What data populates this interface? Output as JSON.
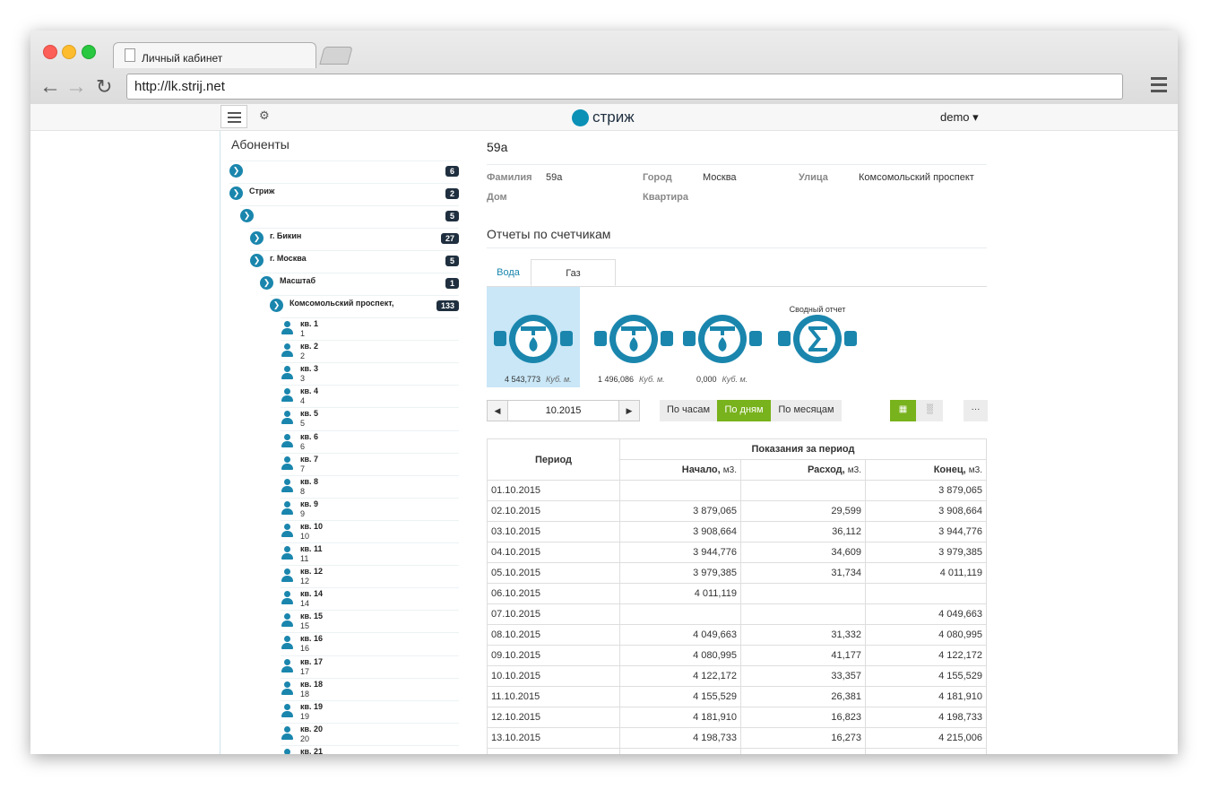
{
  "browser": {
    "tab_title": "Личный кабинет",
    "url": "http://lk.strij.net"
  },
  "topbar": {
    "brand": "стриж",
    "user": "demo ▾"
  },
  "sidebar": {
    "title": "Абоненты",
    "groups": [
      {
        "label": "",
        "count": "6",
        "expanded": false
      },
      {
        "label": "Стриж",
        "count": "2",
        "expanded": true
      },
      {
        "label": "",
        "count": "5",
        "expanded": true
      },
      {
        "label": "г. Бикин",
        "count": "27",
        "expanded": false
      },
      {
        "label": "г. Москва",
        "count": "5",
        "expanded": true
      },
      {
        "label": "Масштаб",
        "count": "1",
        "expanded": true
      },
      {
        "label": "Комсомольский проспект,",
        "count": "133",
        "expanded": true
      }
    ],
    "apartments": [
      {
        "name": "кв. 1",
        "num": "1"
      },
      {
        "name": "кв. 2",
        "num": "2"
      },
      {
        "name": "кв. 3",
        "num": "3"
      },
      {
        "name": "кв. 4",
        "num": "4"
      },
      {
        "name": "кв. 5",
        "num": "5"
      },
      {
        "name": "кв. 6",
        "num": "6"
      },
      {
        "name": "кв. 7",
        "num": "7"
      },
      {
        "name": "кв. 8",
        "num": "8"
      },
      {
        "name": "кв. 9",
        "num": "9"
      },
      {
        "name": "кв. 10",
        "num": "10"
      },
      {
        "name": "кв. 11",
        "num": "11"
      },
      {
        "name": "кв. 12",
        "num": "12"
      },
      {
        "name": "кв. 14",
        "num": "14"
      },
      {
        "name": "кв. 15",
        "num": "15"
      },
      {
        "name": "кв. 16",
        "num": "16"
      },
      {
        "name": "кв. 17",
        "num": "17"
      },
      {
        "name": "кв. 18",
        "num": "18"
      },
      {
        "name": "кв. 19",
        "num": "19"
      },
      {
        "name": "кв. 20",
        "num": "20"
      },
      {
        "name": "кв. 21",
        "num": ""
      }
    ]
  },
  "main": {
    "name": "59а",
    "info": {
      "surname_label": "Фамилия",
      "surname": "59а",
      "city_label": "Город",
      "city": "Москва",
      "street_label": "Улица",
      "street": "Комсомольский проспект",
      "house_label": "Дом",
      "flat_label": "Квартира"
    },
    "reports_title": "Отчеты по счетчикам",
    "tabs": {
      "water": "Вода",
      "gas": "Газ"
    },
    "meters": [
      {
        "value": "4 543,773",
        "unit": "Куб. м."
      },
      {
        "value": "1 496,086",
        "unit": "Куб. м."
      },
      {
        "value": "0,000",
        "unit": "Куб. м."
      }
    ],
    "summary_label": "Сводный отчет",
    "date": "10.2015",
    "period_buttons": {
      "hours": "По часам",
      "days": "По дням",
      "months": "По месяцам"
    },
    "more": "···",
    "table": {
      "h_period": "Период",
      "h_group": "Показания за период",
      "h_start": "Начало,",
      "h_usage": "Расход,",
      "h_end": "Конец,",
      "unit": "м3.",
      "rows": [
        [
          "01.10.2015",
          "",
          "",
          "3 879,065"
        ],
        [
          "02.10.2015",
          "3 879,065",
          "29,599",
          "3 908,664"
        ],
        [
          "03.10.2015",
          "3 908,664",
          "36,112",
          "3 944,776"
        ],
        [
          "04.10.2015",
          "3 944,776",
          "34,609",
          "3 979,385"
        ],
        [
          "05.10.2015",
          "3 979,385",
          "31,734",
          "4 011,119"
        ],
        [
          "06.10.2015",
          "4 011,119",
          "",
          ""
        ],
        [
          "07.10.2015",
          "",
          "",
          "4 049,663"
        ],
        [
          "08.10.2015",
          "4 049,663",
          "31,332",
          "4 080,995"
        ],
        [
          "09.10.2015",
          "4 080,995",
          "41,177",
          "4 122,172"
        ],
        [
          "10.10.2015",
          "4 122,172",
          "33,357",
          "4 155,529"
        ],
        [
          "11.10.2015",
          "4 155,529",
          "26,381",
          "4 181,910"
        ],
        [
          "12.10.2015",
          "4 181,910",
          "16,823",
          "4 198,733"
        ],
        [
          "13.10.2015",
          "4 198,733",
          "16,273",
          "4 215,006"
        ],
        [
          "",
          "",
          "",
          ""
        ]
      ]
    }
  }
}
